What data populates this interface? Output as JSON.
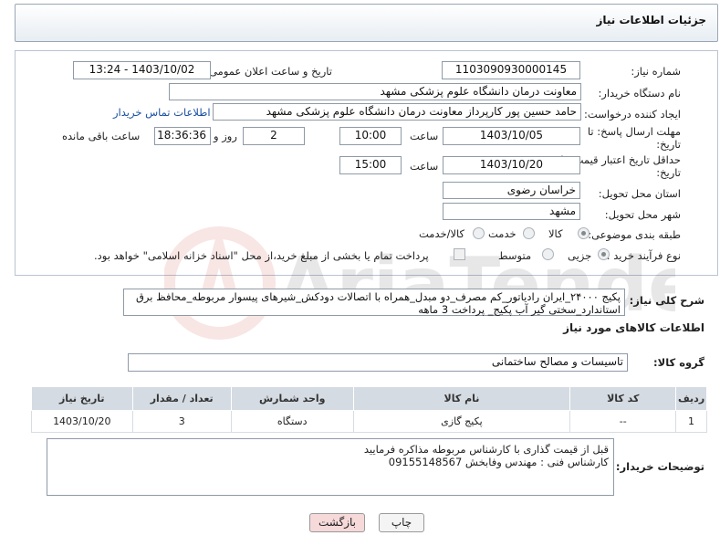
{
  "header": {
    "title": "جزئیات اطلاعات نیاز"
  },
  "form": {
    "need_number_label": "شماره نیاز:",
    "need_number": "1103090930000145",
    "announce_label": "تاریخ و ساعت اعلان عمومی:",
    "announce_value": "1403/10/02 - 13:24",
    "buyer_org_label": "نام دستگاه خریدار:",
    "buyer_org": "معاونت درمان دانشگاه علوم پزشکی مشهد",
    "requester_label": "ایجاد کننده درخواست:",
    "requester": "حامد حسین پور کارپرداز معاونت درمان دانشگاه علوم پزشکی مشهد",
    "contact_link": "اطلاعات تماس خریدار",
    "deadline_label_1": "مهلت ارسال پاسخ: تا",
    "deadline_label_2": "تاریخ:",
    "deadline_date": "1403/10/05",
    "time_label": "ساعت",
    "deadline_time": "10:00",
    "days_value": "2",
    "day_and_label": "روز و",
    "remaining_time": "18:36:36",
    "remaining_label": "ساعت باقی مانده",
    "validity_label_1": "حداقل تاریخ اعتبار قیمت: تا",
    "validity_label_2": "تاریخ:",
    "validity_date": "1403/10/20",
    "validity_time": "15:00",
    "province_label": "استان محل تحویل:",
    "province": "خراسان رضوی",
    "city_label": "شهر محل تحویل:",
    "city": "مشهد",
    "category_label": "طبقه بندی موضوعی:",
    "category_options": [
      "کالا",
      "خدمت",
      "کالا/خدمت"
    ],
    "process_label": "نوع فرآیند خرید :",
    "process_options": [
      "جزیی",
      "متوسط"
    ],
    "payment_note": "پرداخت تمام یا بخشی از مبلغ خرید،از محل \"اسناد خزانه اسلامی\" خواهد بود."
  },
  "description": {
    "label": "شرح کلی نیاز:",
    "text": "پکیج ۲۴۰۰۰_ایران رادیاتور_کم مصرف_دو مبدل_همراه با اتصالات دودکش_شیرهای پیسوار مربوطه_محافظ برق استاندارد_سختی گیر آب پکیج_ پرداخت 3 ماهه"
  },
  "goods": {
    "section_title": "اطلاعات کالاهای مورد نیاز",
    "group_label": "گروه کالا:",
    "group_value": "تاسیسات و مصالح ساختمانی",
    "columns": [
      "ردیف",
      "کد کالا",
      "نام کالا",
      "واحد شمارش",
      "تعداد / مقدار",
      "تاریخ نیاز"
    ],
    "rows": [
      {
        "row": "1",
        "code": "--",
        "name": "پکیج گازی",
        "unit": "دستگاه",
        "qty": "3",
        "date": "1403/10/20"
      }
    ]
  },
  "buyer_notes": {
    "label": "توضیحات خریدار:",
    "line1": "قبل از قیمت گذاری با کارشناس مربوطه مذاکره فرمایید",
    "line2": "کارشناس فنی : مهندس وفابخش 09155148567"
  },
  "buttons": {
    "print": "چاپ",
    "back": "بازگشت"
  },
  "watermark": {
    "text": "AriaTender.net"
  },
  "colors": {
    "accent": "#1a4fa3",
    "header_bg": "#e7edf3",
    "table_header": "#d4dbe3",
    "back_button": "#f6d9d9"
  }
}
